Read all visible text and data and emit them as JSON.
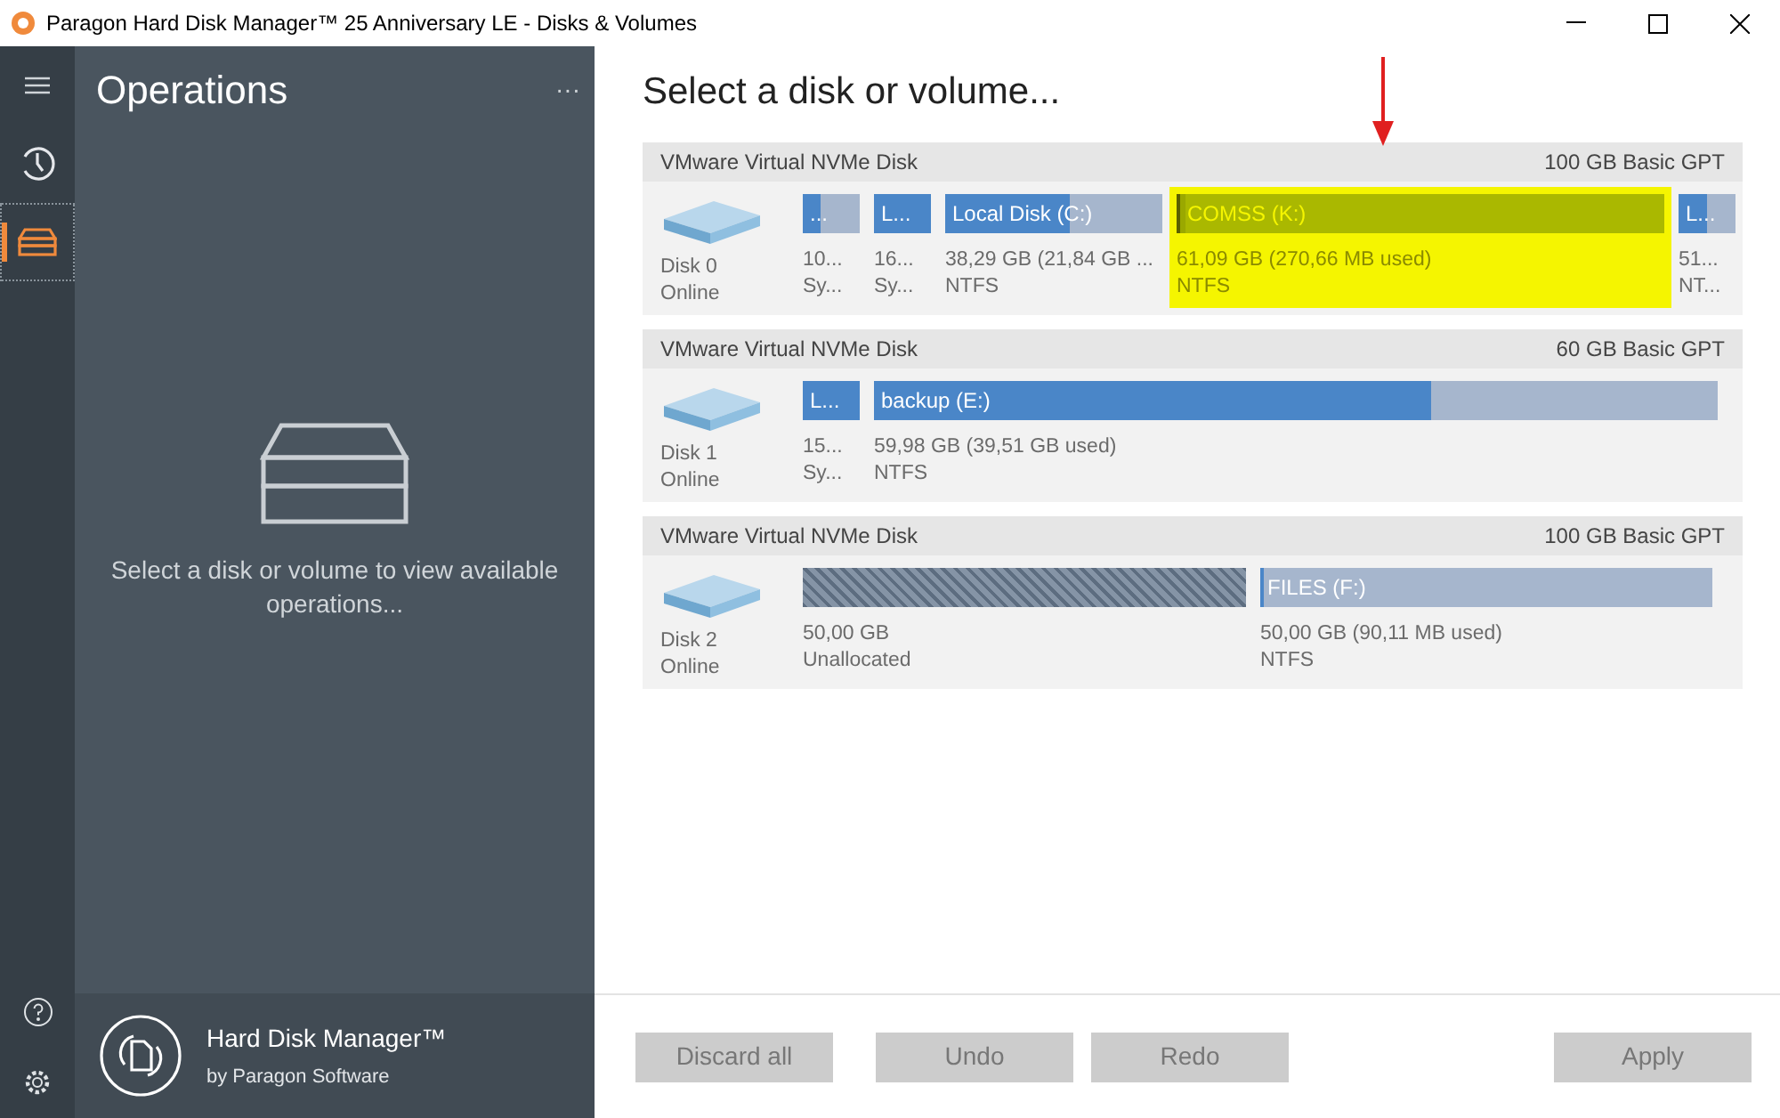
{
  "window": {
    "title": "Paragon Hard Disk Manager™ 25 Anniversary LE - Disks & Volumes"
  },
  "rail": {
    "items": [
      {
        "kind": "history",
        "selected": false
      },
      {
        "kind": "disks",
        "selected": true
      }
    ]
  },
  "operations": {
    "title": "Operations",
    "more": "···",
    "empty_message": "Select a disk or volume to view available operations..."
  },
  "product": {
    "name": "Hard Disk Manager™",
    "vendor": "by Paragon Software"
  },
  "main": {
    "heading": "Select a disk or volume..."
  },
  "disks": [
    {
      "model": "VMware Virtual NVMe Disk",
      "summary": "100 GB Basic GPT",
      "name": "Disk 0",
      "status": "Online",
      "partitions": [
        {
          "kind": "volume",
          "label": "...",
          "line1": "10...",
          "line2": "Sy...",
          "level": 0.3,
          "highlighted": false
        },
        {
          "kind": "volume",
          "label": "L...",
          "line1": "16...",
          "line2": "Sy...",
          "level": 1,
          "highlighted": false
        },
        {
          "kind": "volume",
          "label": "Local Disk (C:)",
          "line1": "38,29 GB (21,84 GB ...",
          "line2": "NTFS",
          "level": 0.57,
          "highlighted": false
        },
        {
          "kind": "volume",
          "label": "COMSS (K:)",
          "line1": "61,09 GB (270,66 MB used)",
          "line2": "NTFS",
          "level": 0.01,
          "highlighted": true
        },
        {
          "kind": "volume",
          "label": "L...",
          "line1": "51...",
          "line2": "NT...",
          "level": 0.5,
          "highlighted": false
        }
      ]
    },
    {
      "model": "VMware Virtual NVMe Disk",
      "summary": "60 GB Basic GPT",
      "name": "Disk 1",
      "status": "Online",
      "partitions": [
        {
          "kind": "volume",
          "label": "L...",
          "line1": "15...",
          "line2": "Sy...",
          "level": 1,
          "highlighted": false
        },
        {
          "kind": "volume",
          "label": "backup (E:)",
          "line1": "59,98 GB (39,51 GB used)",
          "line2": "NTFS",
          "level": 0.66,
          "highlighted": false
        }
      ]
    },
    {
      "model": "VMware Virtual NVMe Disk",
      "summary": "100 GB Basic GPT",
      "name": "Disk 2",
      "status": "Online",
      "partitions": [
        {
          "kind": "unallocated",
          "line1": "50,00 GB",
          "line2": "Unallocated",
          "highlighted": false
        },
        {
          "kind": "volume",
          "label": "FILES (F:)",
          "line1": "50,00 GB (90,11 MB used)",
          "line2": "NTFS",
          "level": 0.0,
          "highlighted": false
        }
      ]
    }
  ],
  "footer": {
    "buttons": [
      {
        "label": "Discard all",
        "disabled": true
      },
      {
        "label": "Undo",
        "disabled": true
      },
      {
        "label": "Redo",
        "disabled": true
      },
      {
        "label": "Apply",
        "disabled": true
      }
    ]
  }
}
